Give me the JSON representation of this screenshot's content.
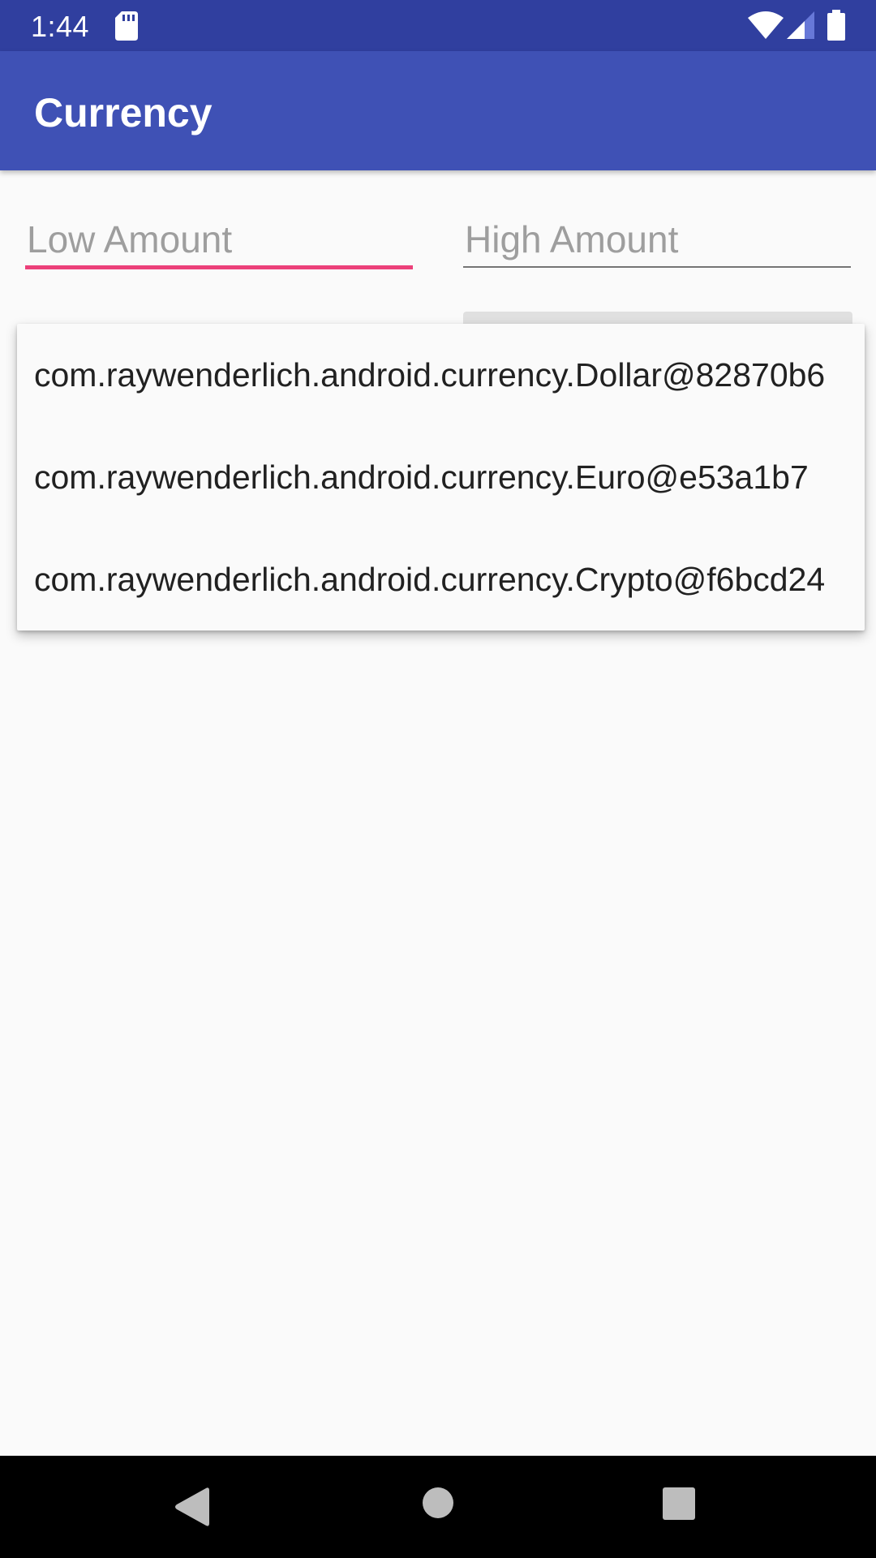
{
  "status_bar": {
    "time": "1:44",
    "icons": [
      "sd-card-icon",
      "wifi-icon",
      "cell-signal-icon",
      "battery-icon"
    ]
  },
  "app_bar": {
    "title": "Currency"
  },
  "form": {
    "low_amount": {
      "value": "",
      "placeholder": "Low Amount"
    },
    "high_amount": {
      "value": "",
      "placeholder": "High Amount"
    }
  },
  "dropdown": {
    "items": [
      {
        "label": "com.raywenderlich.android.currency.Dollar@82870b6"
      },
      {
        "label": "com.raywenderlich.android.currency.Euro@e53a1b7"
      },
      {
        "label": "com.raywenderlich.android.currency.Crypto@f6bcd24"
      }
    ]
  },
  "nav_bar": {
    "buttons": [
      "back-icon",
      "home-icon",
      "recents-icon"
    ]
  },
  "colors": {
    "status_bar": "#303f9f",
    "primary": "#3f51b5",
    "accent": "#ec407a",
    "background": "#fafafa"
  }
}
